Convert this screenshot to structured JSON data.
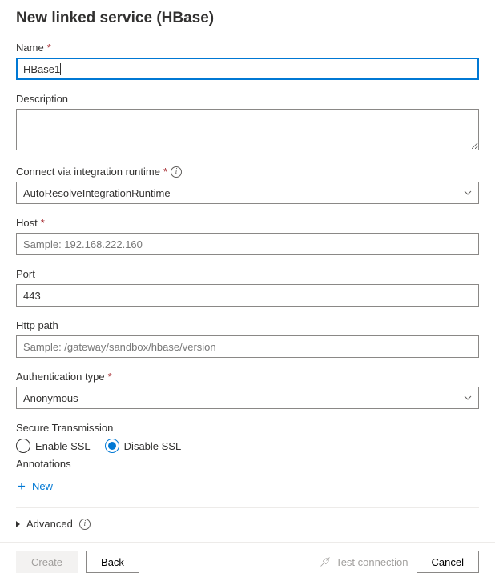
{
  "title": "New linked service (HBase)",
  "fields": {
    "name": {
      "label": "Name",
      "value": "HBase1",
      "required": true
    },
    "description": {
      "label": "Description",
      "value": ""
    },
    "runtime": {
      "label": "Connect via integration runtime",
      "value": "AutoResolveIntegrationRuntime",
      "required": true,
      "info": true
    },
    "host": {
      "label": "Host",
      "placeholder": "Sample: 192.168.222.160",
      "value": "",
      "required": true
    },
    "port": {
      "label": "Port",
      "value": "443"
    },
    "httppath": {
      "label": "Http path",
      "placeholder": "Sample: /gateway/sandbox/hbase/version",
      "value": ""
    },
    "authtype": {
      "label": "Authentication type",
      "value": "Anonymous",
      "required": true
    }
  },
  "secureTransmission": {
    "label": "Secure Transmission",
    "options": {
      "enable": "Enable SSL",
      "disable": "Disable SSL"
    },
    "selected": "disable"
  },
  "annotations": {
    "label": "Annotations",
    "newLabel": "New"
  },
  "advanced": {
    "label": "Advanced"
  },
  "footer": {
    "create": "Create",
    "back": "Back",
    "test": "Test connection",
    "cancel": "Cancel"
  }
}
